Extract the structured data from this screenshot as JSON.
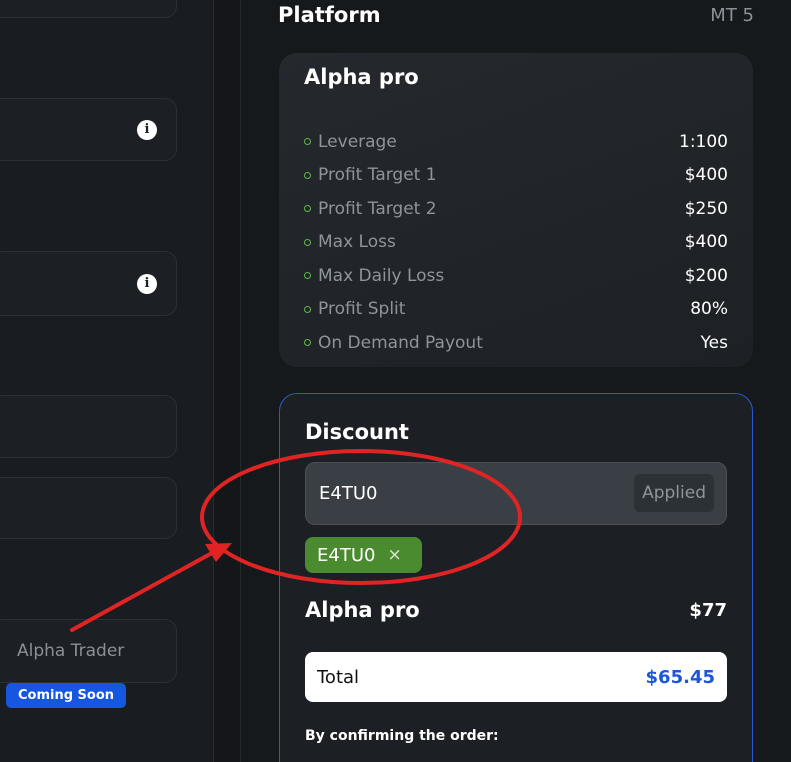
{
  "left_panel": {
    "alpha_trader_label": "Alpha Trader",
    "coming_soon_badge": "Coming Soon"
  },
  "platform": {
    "label": "Platform",
    "value": "MT 5"
  },
  "plan_card": {
    "title": "Alpha pro",
    "specs": [
      {
        "label": "Leverage",
        "value": "1:100"
      },
      {
        "label": "Profit Target 1",
        "value": "$400"
      },
      {
        "label": "Profit Target 2",
        "value": "$250"
      },
      {
        "label": "Max Loss",
        "value": "$400"
      },
      {
        "label": "Max Daily Loss",
        "value": "$200"
      },
      {
        "label": "Profit Split",
        "value": "80%"
      },
      {
        "label": "On Demand Payout",
        "value": "Yes"
      }
    ]
  },
  "discount": {
    "title": "Discount",
    "code_value": "E4TU0",
    "applied_label": "Applied",
    "chip_code": "E4TU0",
    "chip_close_glyph": "×"
  },
  "summary": {
    "plan_name": "Alpha pro",
    "plan_price": "$77",
    "total_label": "Total",
    "total_value": "$65.45",
    "confirm_text": "By confirming the order:"
  },
  "colors": {
    "accent_blue": "#1c56db",
    "chip_green": "#4b8b2f",
    "bullet_green": "#5fb84a",
    "annotation_red": "#e02424"
  }
}
